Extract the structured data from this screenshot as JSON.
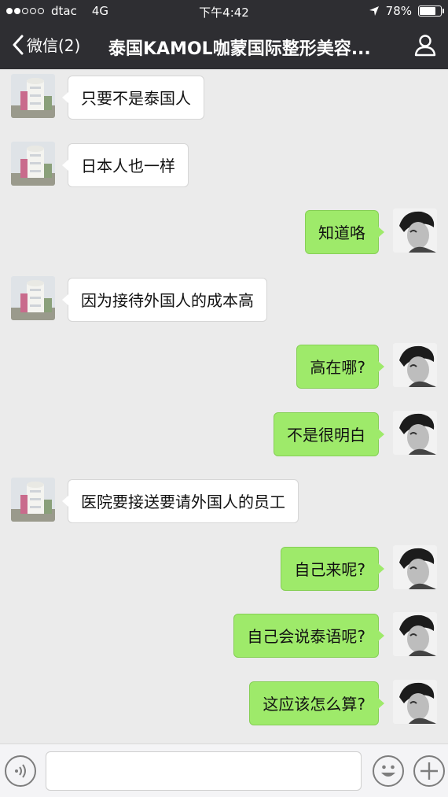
{
  "status_bar": {
    "carrier": "dtac",
    "network": "4G",
    "time": "下午4:42",
    "battery": "78%",
    "battery_level": 0.78
  },
  "nav": {
    "back_label": "微信(2)",
    "title": "泰国KAMOL咖蒙国际整形美容..."
  },
  "messages": [
    {
      "side": "in",
      "text": "只要不是泰国人"
    },
    {
      "side": "in",
      "text": "日本人也一样"
    },
    {
      "side": "out",
      "text": "知道咯"
    },
    {
      "side": "in",
      "text": "因为接待外国人的成本高"
    },
    {
      "side": "out",
      "text": "高在哪?"
    },
    {
      "side": "out",
      "text": "不是很明白"
    },
    {
      "side": "in",
      "text": "医院要接送要请外国人的员工"
    },
    {
      "side": "out",
      "text": "自己来呢?"
    },
    {
      "side": "out",
      "text": "自己会说泰语呢?"
    },
    {
      "side": "out",
      "text": "这应该怎么算?"
    }
  ],
  "input": {
    "value": "",
    "placeholder": ""
  }
}
